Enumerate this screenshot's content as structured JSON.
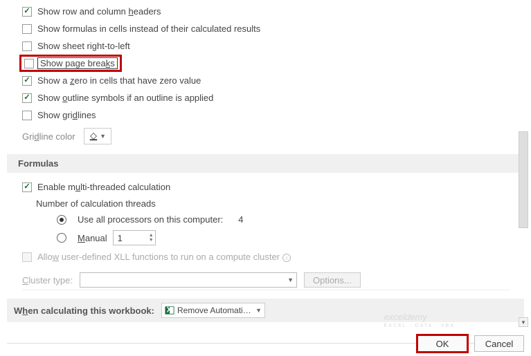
{
  "options": {
    "row_col_headers": "Show row and column headers",
    "show_formulas": "Show formulas in cells instead of their calculated results",
    "sheet_rtl": "Show sheet right-to-left",
    "page_breaks": "Show page breaks",
    "zero_value": "Show a zero in cells that have zero value",
    "outline_symbols": "Show outline symbols if an outline is applied",
    "gridlines": "Show gridlines",
    "gridline_color_label": "Gridline color"
  },
  "formulas_section": {
    "header": "Formulas",
    "multi_threaded": "Enable multi-threaded calculation",
    "threads_label": "Number of calculation threads",
    "use_all_processors": "Use all processors on this computer:",
    "processor_count": "4",
    "manual_label": "Manual",
    "manual_value": "1",
    "xll_label": "Allow user-defined XLL functions to run on a compute cluster",
    "cluster_type_label": "Cluster type:",
    "options_btn": "Options..."
  },
  "workbook": {
    "label": "When calculating this workbook:",
    "selected": "Remove Automatic..."
  },
  "buttons": {
    "ok": "OK",
    "cancel": "Cancel"
  },
  "watermark": {
    "main": "exceldemy",
    "sub": "EXCEL · DATA · VBA"
  }
}
